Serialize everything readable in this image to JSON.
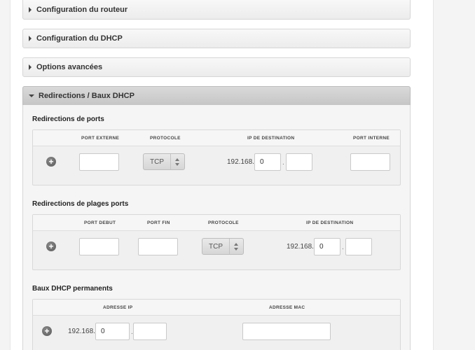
{
  "accordion": {
    "router": "Configuration du routeur",
    "dhcp": "Configuration du DHCP",
    "advanced": "Options avancées",
    "redirections": "Redirections / Baux DHCP"
  },
  "port_redirections": {
    "title": "Redirections de ports",
    "columns": {
      "external_port": "PORT EXTERNE",
      "protocol": "PROTOCOLE",
      "destination_ip": "IP DE DESTINATION",
      "internal_port": "PORT INTERNE"
    },
    "row": {
      "external_port": "",
      "protocol": "TCP",
      "ip_prefix": "192.168.",
      "ip_octet3": "0",
      "ip_dot": ".",
      "ip_octet4": "",
      "internal_port": ""
    },
    "add_label": "+"
  },
  "range_redirections": {
    "title": "Redirections de plages ports",
    "columns": {
      "start_port": "PORT DEBUT",
      "end_port": "PORT FIN",
      "protocol": "PROTOCOLE",
      "destination_ip": "IP DE DESTINATION"
    },
    "row": {
      "start_port": "",
      "end_port": "",
      "protocol": "TCP",
      "ip_prefix": "192.168.",
      "ip_octet3": "0",
      "ip_dot": ".",
      "ip_octet4": ""
    },
    "add_label": "+"
  },
  "dhcp_leases": {
    "title": "Baux DHCP permanents",
    "columns": {
      "ip_address": "ADRESSE IP",
      "mac_address": "ADRESSE MAC"
    },
    "row": {
      "ip_prefix": "192.168.",
      "ip_octet3": "0",
      "ip_dot": ".",
      "ip_octet4": "",
      "mac": ""
    },
    "add_label": "+"
  }
}
